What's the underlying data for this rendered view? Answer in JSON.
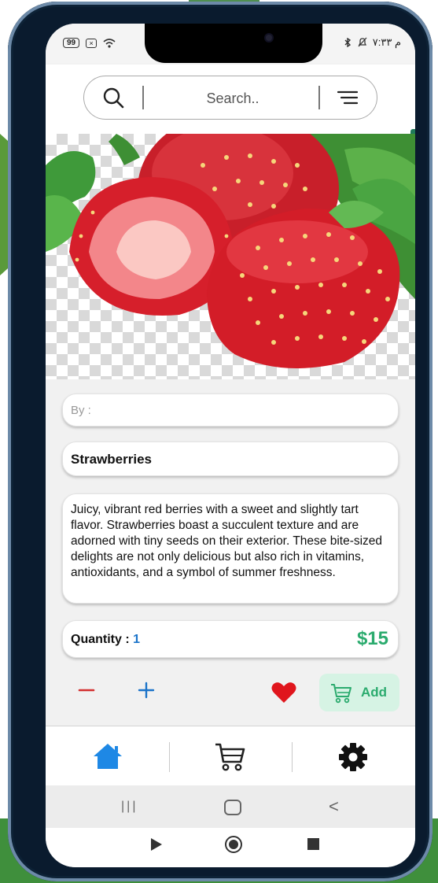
{
  "status_bar": {
    "battery": "99",
    "time_rtl": "م ٧:٣٣"
  },
  "search": {
    "placeholder": "Search.."
  },
  "product": {
    "image_icon": "strawberries-photo",
    "by_label": "By :",
    "name": "Strawberries",
    "description": "Juicy, vibrant red berries with a sweet and slightly tart flavor. Strawberries boast a succulent texture and are adorned with tiny seeds on their exterior. These bite-sized delights are not only delicious but also rich in vitamins, antioxidants, and a symbol of summer freshness.",
    "quantity_label": "Quantity : ",
    "quantity_value": "1",
    "price": "$15"
  },
  "actions": {
    "add_label": "Add",
    "favorited": true
  },
  "colors": {
    "accent_green": "#2bab6e",
    "accent_blue": "#1a73c9",
    "minus_red": "#d32f2f",
    "heart_red": "#e0161d",
    "add_bg": "#d6f3e4",
    "home_blue": "#1e88e5"
  },
  "bottom_nav": {
    "items": [
      {
        "icon": "home-icon",
        "active": true
      },
      {
        "icon": "cart-icon",
        "active": false
      },
      {
        "icon": "settings-gear-icon",
        "active": false
      }
    ]
  },
  "system_nav": {
    "recents_glyph": "|||",
    "back_glyph": "<"
  }
}
